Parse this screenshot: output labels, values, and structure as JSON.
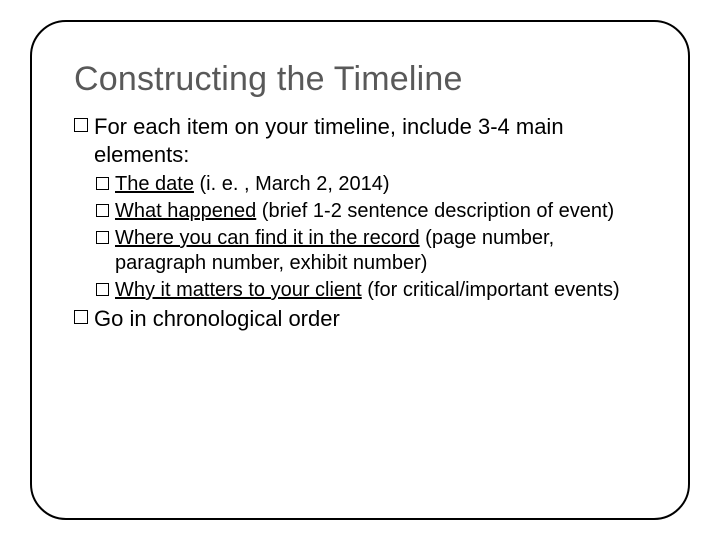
{
  "title": "Constructing the Timeline",
  "b1": {
    "text": "For each item on your timeline, include 3-4 main elements:"
  },
  "sub": {
    "s1": {
      "u": "The date",
      "rest": " (i. e. , March 2, 2014)"
    },
    "s2": {
      "u": "What happened",
      "rest": " (brief 1-2 sentence description of event)"
    },
    "s3": {
      "u": "Where you can find it in the record",
      "rest": " (page number, paragraph number, exhibit number)"
    },
    "s4": {
      "u": "Why it matters to your client",
      "rest": " (for critical/important events)"
    }
  },
  "b2": {
    "text": "Go in chronological order"
  }
}
